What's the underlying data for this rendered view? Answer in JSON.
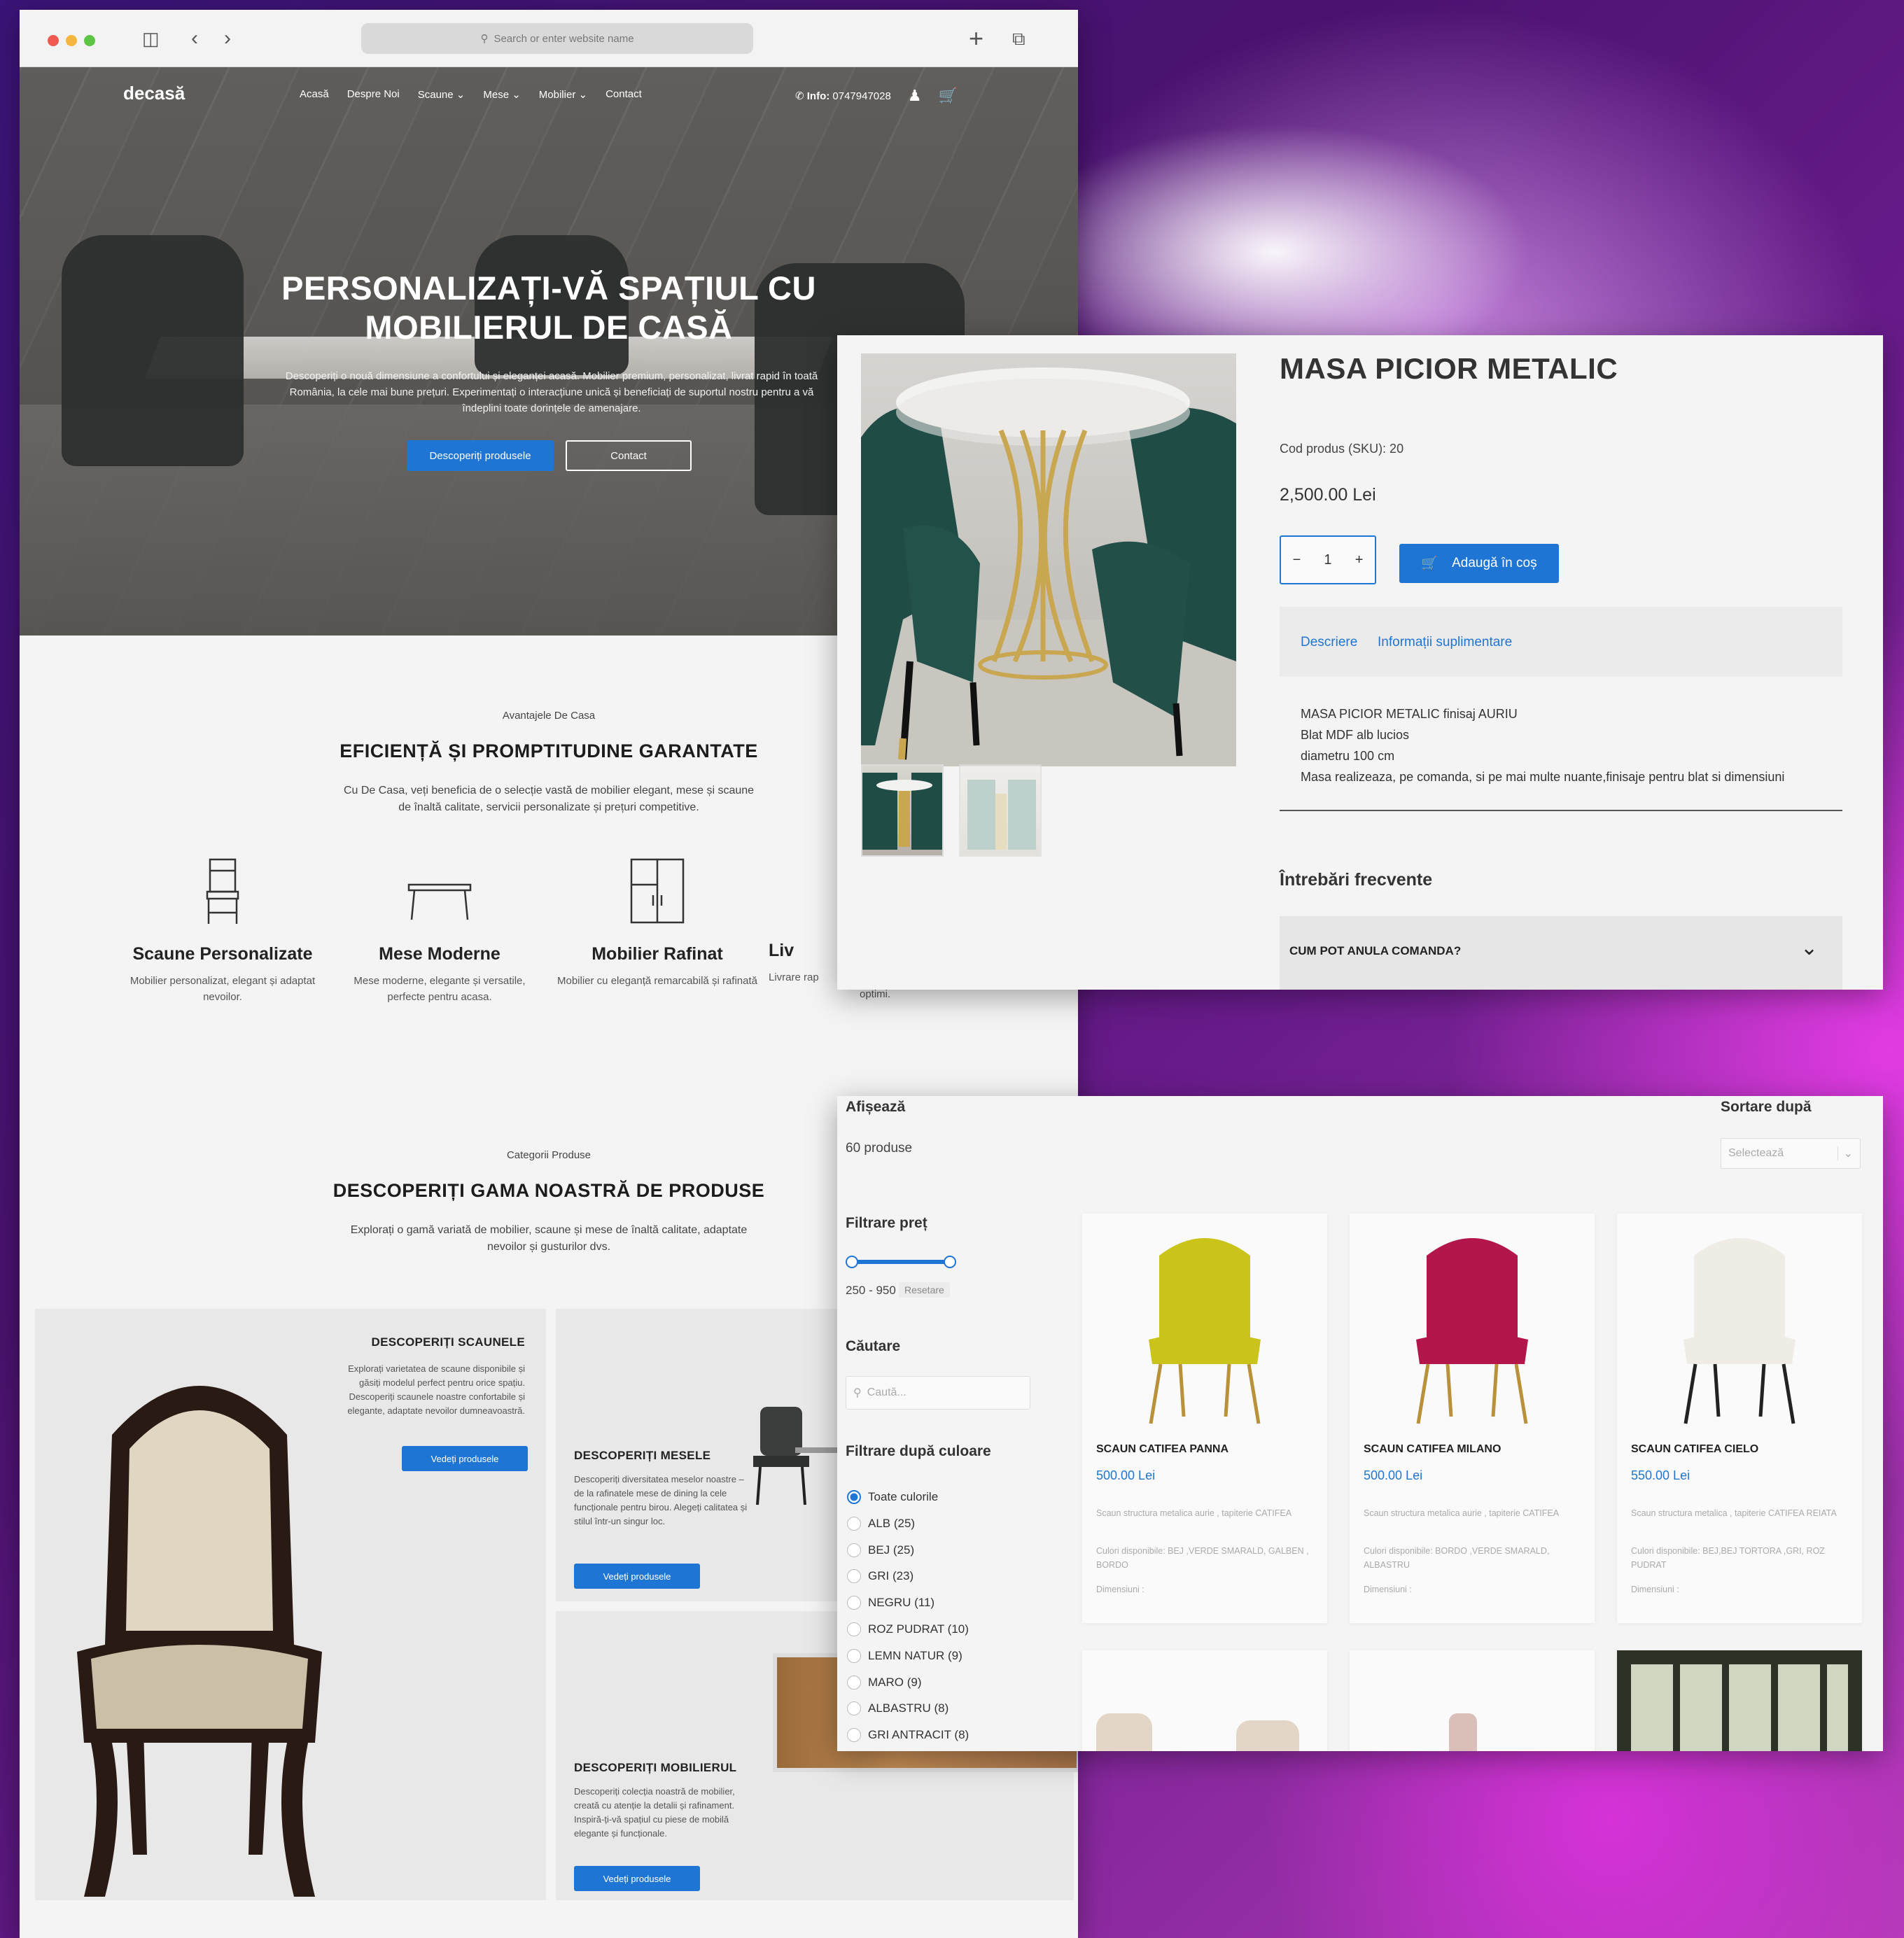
{
  "browser": {
    "address_placeholder": "Search or enter website name"
  },
  "site": {
    "logo": "decasă",
    "nav": [
      "Acasă",
      "Despre Noi",
      "Scaune",
      "Mese",
      "Mobilier",
      "Contact"
    ],
    "info_label": "Info:",
    "phone": "0747947028"
  },
  "hero": {
    "title_line1": "PERSONALIZAȚI-VĂ SPAȚIUL CU",
    "title_line2": "MOBILIERUL DE CASĂ",
    "subtitle": "Descoperiți o nouă dimensiune a confortului și eleganței acasă. Mobilier premium, personalizat, livrat rapid în toată România, la cele mai bune prețuri. Experimentați o interacțiune unică și beneficiați de suportul nostru pentru a vă îndeplini toate dorințele de amenajare.",
    "primary_button": "Descoperiți produsele",
    "secondary_button": "Contact"
  },
  "advantages": {
    "label": "Avantajele De Casa",
    "title": "EFICIENȚĂ ȘI PROMPTITUDINE GARANTATE",
    "description": "Cu De Casa, veți beneficia de o selecție vastă de mobilier elegant, mese și scaune de înaltă calitate, servicii personalizate și prețuri competitive.",
    "items": [
      {
        "title": "Scaune Personalizate",
        "desc": "Mobilier personalizat, elegant și adaptat nevoilor."
      },
      {
        "title": "Mese Moderne",
        "desc": "Mese moderne, elegante și versatile, perfecte pentru acasa."
      },
      {
        "title": "Mobilier Rafinat",
        "desc": "Mobilier cu eleganță remarcabilă și rafinată"
      },
      {
        "title": "Liv",
        "desc": "Livrare rap"
      }
    ],
    "overflow_text": "optimi."
  },
  "categories": {
    "label": "Categorii Produse",
    "title": "DESCOPERIȚI GAMA NOASTRĂ DE PRODUSE",
    "description": "Explorați o gamă variată de mobilier, scaune și mese de înaltă calitate, adaptate nevoilor și gusturilor dvs.",
    "chairs": {
      "title": "DESCOPERIȚI SCAUNELE",
      "desc": "Explorați varietatea de scaune disponibile și găsiți modelul perfect pentru orice spațiu. Descoperiți scaunele noastre confortabile și elegante, adaptate nevoilor dumneavoastră.",
      "button": "Vedeți produsele"
    },
    "tables": {
      "title": "DESCOPERIȚI MESELE",
      "desc": "Descoperiți diversitatea meselor noastre – de la rafinatele mese de dining la cele funcționale pentru birou. Alegeți calitatea și stilul într-un singur loc.",
      "button": "Vedeți produsele"
    },
    "furniture": {
      "title": "DESCOPERIȚI MOBILIERUL",
      "desc": "Descoperiți colecția noastră de mobilier, creată cu atenție la detalii și rafinament. Inspiră-ți-vă spațiul cu piese de mobilă elegante și funcționale.",
      "button": "Vedeți produsele"
    }
  },
  "product": {
    "title": "MASA PICIOR METALIC",
    "sku": "Cod produs (SKU): 20",
    "price": "2,500.00 Lei",
    "quantity": "1",
    "add_to_cart": "Adaugă în coș",
    "tabs": [
      "Descriere",
      "Informații suplimentare"
    ],
    "description_lines": [
      "MASA PICIOR METALIC finisaj AURIU",
      "Blat MDF alb lucios",
      "diametru 100 cm",
      "Masa realizeaza, pe comanda, si pe mai multe nuante,finisaje pentru blat si dimensiuni"
    ],
    "faq_title": "Întrebări frecvente",
    "faq_question": "CUM POT ANULA COMANDA?"
  },
  "shop": {
    "show_label": "Afișează",
    "count": "60 produse",
    "sort_label": "Sortare după",
    "sort_placeholder": "Selectează",
    "price_filter_label": "Filtrare preț",
    "price_range": "250 - 950",
    "price_min": 250,
    "price_max": 950,
    "reset": "Resetare",
    "search_label": "Căutare",
    "search_placeholder": "Caută...",
    "color_filter_label": "Filtrare după culoare",
    "colors": [
      "Toate culorile",
      "ALB (25)",
      "BEJ (25)",
      "GRI (23)",
      "NEGRU (11)",
      "ROZ PUDRAT (10)",
      "LEMN NATUR (9)",
      "MARO (9)",
      "ALBASTRU (8)",
      "GRI ANTRACIT (8)"
    ],
    "products": [
      {
        "name": "SCAUN CATIFEA PANNA",
        "price": "500.00 Lei",
        "desc": "Scaun structura metalica aurie , tapiterie CATIFEA",
        "colors": "Culori disponibile: BEJ ,VERDE SMARALD, GALBEN , BORDO",
        "dims": "Dimensiuni :",
        "color": "#c9c31a",
        "leg": "#b8913a"
      },
      {
        "name": "SCAUN CATIFEA MILANO",
        "price": "500.00 Lei",
        "desc": "Scaun structura metalica aurie , tapiterie CATIFEA",
        "colors": "Culori disponibile: BORDO ,VERDE SMARALD, ALBASTRU",
        "dims": "Dimensiuni :",
        "color": "#b3164a",
        "leg": "#b8913a"
      },
      {
        "name": "SCAUN CATIFEA CIELO",
        "price": "550.00 Lei",
        "desc": "Scaun structura metalica , tapiterie CATIFEA REIATA",
        "colors": "Culori disponibile: BEJ,BEJ TORTORA ,GRI, ROZ PUDRAT",
        "dims": "Dimensiuni :",
        "color": "#efece6",
        "leg": "#222222"
      }
    ]
  },
  "colors": {
    "accent": "#1f75d3",
    "dark_text": "#1c1c1c"
  }
}
